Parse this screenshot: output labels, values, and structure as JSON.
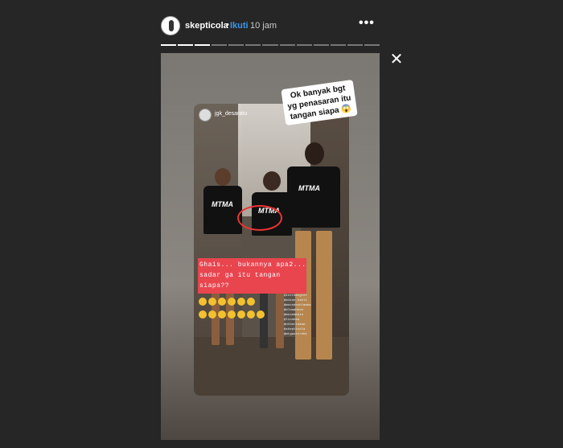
{
  "header": {
    "username": "skepticola",
    "separator": "•",
    "follow_label": "Ikuti",
    "time": "10 jam",
    "more_glyph": "•••"
  },
  "progress": {
    "segments_total": 13,
    "segments_done": 3
  },
  "close_glyph": "✕",
  "story": {
    "caption_sticker": "Ok banyak bgt yg penasaran itu tangan siapa 😱",
    "embedded_username": "jgk_desaratu",
    "shirt_logo": "MTMA",
    "banner_line1": "Ghais... bukannya apa2...",
    "banner_line2": "sadar ga itu tangan",
    "banner_line3": "siapa??",
    "tags": [
      "@intrdaigret",
      "@aikon.kaoli",
      "@mocodoshlamba",
      "@blowahkon",
      "@mosemedia",
      "@lionnew",
      "@ntboridauw",
      "@skepticola",
      "@mtgautirehe"
    ]
  },
  "colors": {
    "accent": "#3897f0",
    "banner": "#e8454f",
    "circle": "#ee3333"
  }
}
